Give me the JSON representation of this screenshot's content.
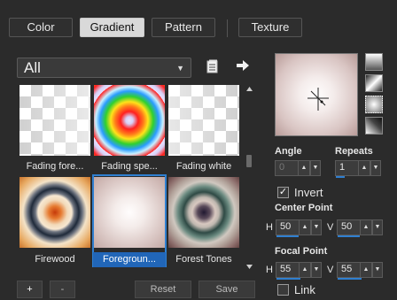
{
  "tabs": [
    {
      "label": "Color",
      "active": false
    },
    {
      "label": "Gradient",
      "active": true
    },
    {
      "label": "Pattern",
      "active": false
    },
    {
      "label": "Texture",
      "active": false
    }
  ],
  "category": {
    "value": "All"
  },
  "icons": {
    "library": "library-icon",
    "navigate": "arrow-right-icon"
  },
  "gradients": [
    {
      "name": "Fading fore..."
    },
    {
      "name": "Fading spe..."
    },
    {
      "name": "Fading white"
    },
    {
      "name": "Firewood"
    },
    {
      "name": "Foregroun...",
      "selected": true
    },
    {
      "name": "Forest Tones"
    }
  ],
  "buttons": {
    "add": "+",
    "remove": "-",
    "reset": "Reset",
    "save": "Save"
  },
  "settings": {
    "angle_label": "Angle",
    "angle_value": "0",
    "repeats_label": "Repeats",
    "repeats_value": "1",
    "invert_label": "Invert",
    "invert_checked": true,
    "center_label": "Center Point",
    "center_h": "50",
    "center_v": "50",
    "focal_label": "Focal Point",
    "focal_h": "55",
    "focal_v": "55",
    "link_label": "Link",
    "link_checked": false,
    "h_label": "H",
    "v_label": "V"
  },
  "colors": {
    "accent": "#2f7fd0",
    "selected_label_bg": "#2166b8",
    "panel_bg": "#2b2b2b"
  }
}
